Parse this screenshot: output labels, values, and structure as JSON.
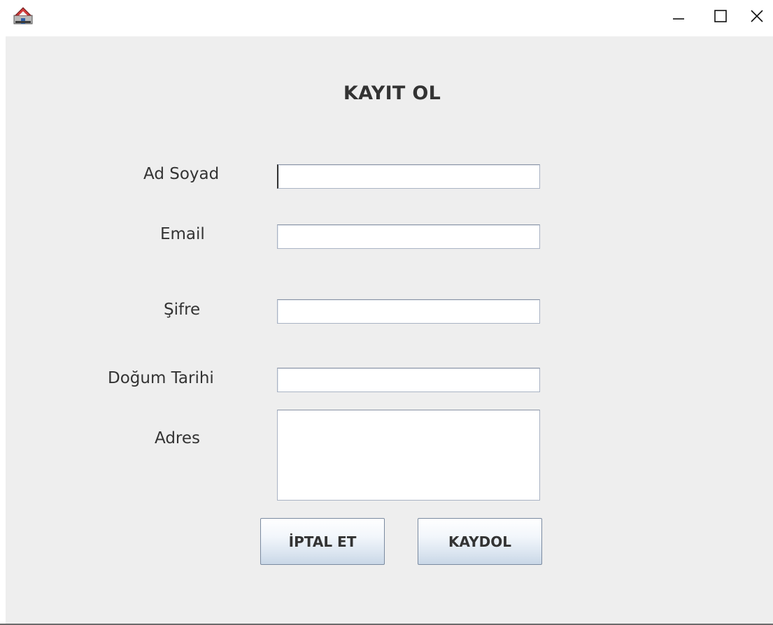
{
  "window": {
    "controls": {
      "minimize": "—",
      "maximize": "☐",
      "close": "✕"
    }
  },
  "form": {
    "title": "KAYIT OL",
    "fields": [
      {
        "label": "Ad Soyad",
        "value": ""
      },
      {
        "label": "Email",
        "value": ""
      },
      {
        "label": "Şifre",
        "value": ""
      },
      {
        "label": "Doğum Tarihi",
        "value": ""
      }
    ],
    "address": {
      "label": "Adres",
      "value": ""
    },
    "buttons": {
      "cancel": "İPTAL ET",
      "save": "KAYDOL"
    }
  },
  "icons": {
    "app": "java-app-icon",
    "minimize": "minimize-icon",
    "maximize": "maximize-icon",
    "close": "close-icon"
  }
}
